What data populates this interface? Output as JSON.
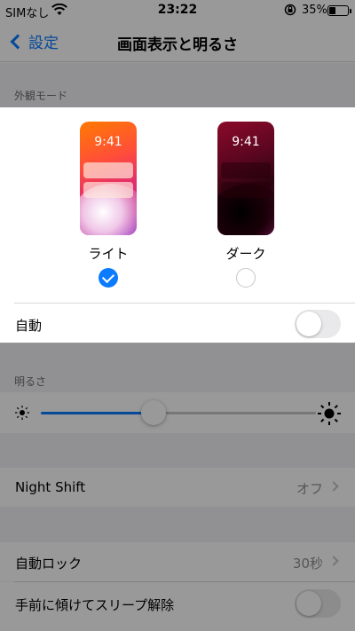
{
  "status": {
    "carrier": "SIMなし",
    "time": "23:22",
    "battery_percent": "35%",
    "battery_level": 0.35
  },
  "nav": {
    "back_label": "設定",
    "title": "画面表示と明るさ"
  },
  "appearance": {
    "section_header": "外観モード",
    "light": {
      "label": "ライト",
      "preview_time": "9:41",
      "selected": true
    },
    "dark": {
      "label": "ダーク",
      "preview_time": "9:41",
      "selected": false
    },
    "auto_label": "自動",
    "auto_on": false
  },
  "brightness": {
    "section_header": "明るさ",
    "level": 0.41
  },
  "night_shift": {
    "label": "Night Shift",
    "value": "オフ"
  },
  "auto_lock": {
    "label": "自動ロック",
    "value": "30秒"
  },
  "raise_to_wake": {
    "label": "手前に傾けてスリープ解除",
    "on": false
  },
  "colors": {
    "accent": "#0a7aff",
    "background": "#f2f2f7",
    "dim_overlay": "rgba(0,0,0,0.4)"
  }
}
